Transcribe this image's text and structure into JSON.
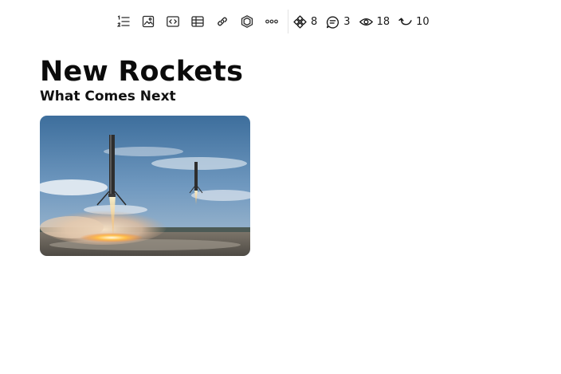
{
  "toolbar": {
    "tools": [
      {
        "name": "ordered-list-icon"
      },
      {
        "name": "image-icon"
      },
      {
        "name": "code-block-icon"
      },
      {
        "name": "table-icon"
      },
      {
        "name": "link-icon"
      },
      {
        "name": "cube-icon"
      },
      {
        "name": "more-icon"
      }
    ],
    "stats": {
      "components": {
        "icon": "components-icon",
        "value": "8"
      },
      "comments": {
        "icon": "comment-icon",
        "value": "3"
      },
      "views": {
        "icon": "eye-icon",
        "value": "18"
      },
      "versions": {
        "icon": "history-icon",
        "value": "10"
      }
    }
  },
  "document": {
    "title": "New Rockets",
    "subtitle": "What Comes Next",
    "image": {
      "subject": "two-rocket-boosters-landing"
    }
  }
}
